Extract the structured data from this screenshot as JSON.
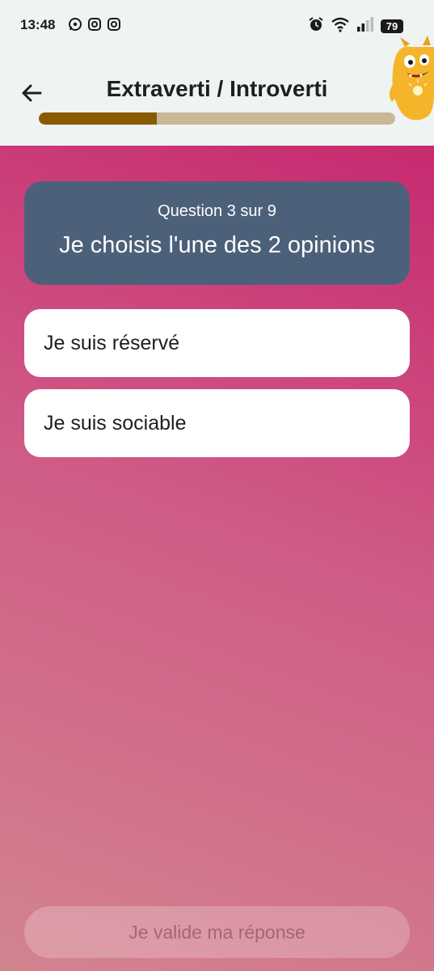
{
  "status_bar": {
    "time": "13:48",
    "notification_icons": [
      "whatsapp-icon",
      "instagram-icon",
      "instagram-icon"
    ],
    "system_icons": [
      "alarm-icon",
      "wifi-icon",
      "signal-icon"
    ],
    "battery": "79"
  },
  "header": {
    "title": "Extraverti / Introverti",
    "back_icon": "arrow-left-icon",
    "progress": {
      "current": 3,
      "total": 9,
      "fraction": 0.33
    }
  },
  "question": {
    "counter": "Question 3 sur 9",
    "prompt": "Je choisis l'une des 2 opinions"
  },
  "options": [
    {
      "label": "Je suis réservé"
    },
    {
      "label": "Je suis sociable"
    }
  ],
  "footer": {
    "submit_label": "Je valide ma réponse"
  },
  "colors": {
    "header_bg": "#edf4f2",
    "progress_fill": "#8a5a00",
    "progress_track": "#c8b898",
    "question_card_bg": "#4d607a",
    "gradient_top": "#c72a70",
    "gradient_bottom": "#d2848e"
  }
}
